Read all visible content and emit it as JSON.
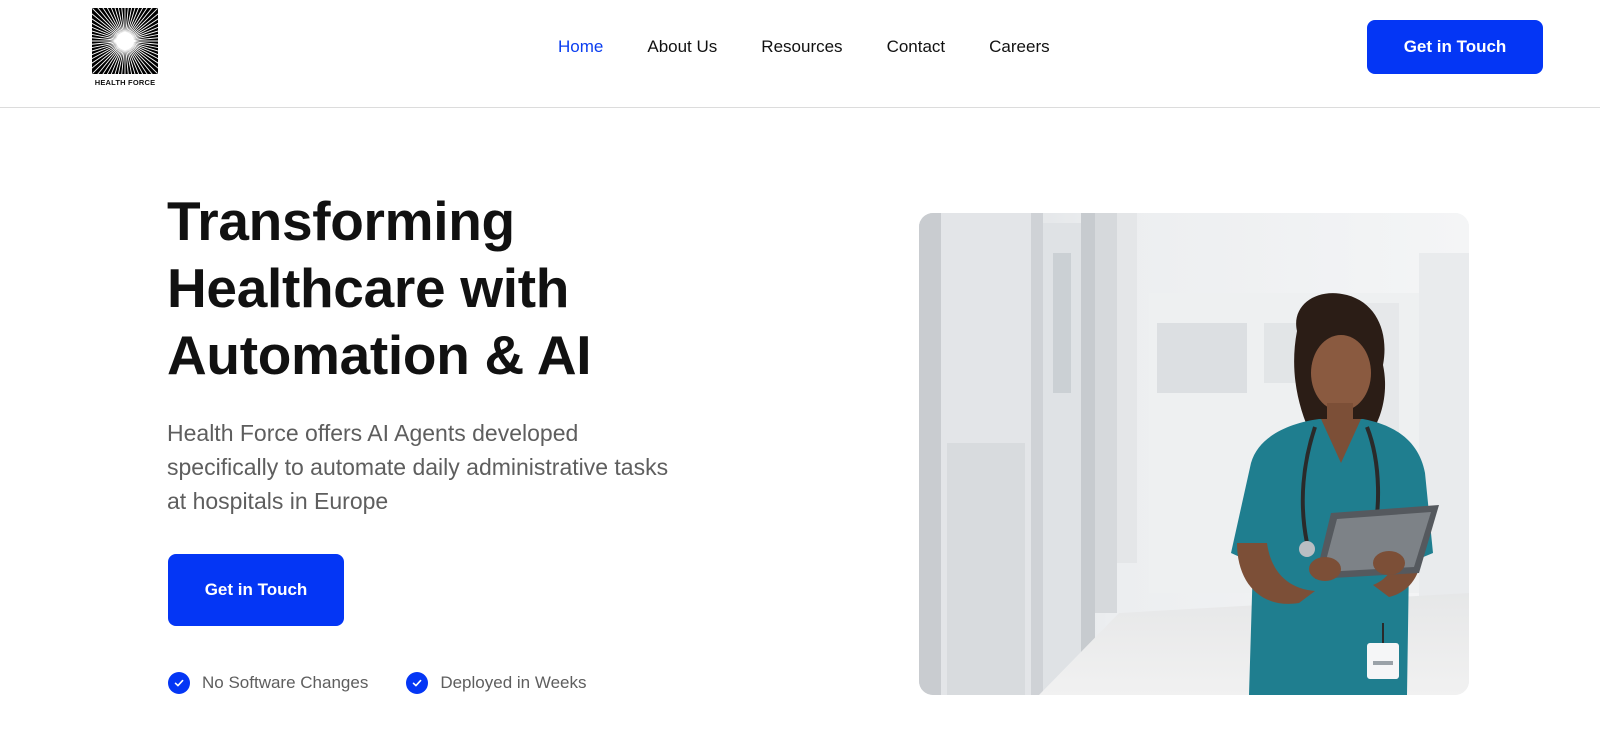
{
  "brand": {
    "name": "HEALTH FORCE"
  },
  "nav": {
    "items": [
      {
        "label": "Home",
        "active": true
      },
      {
        "label": "About Us",
        "active": false
      },
      {
        "label": "Resources",
        "active": false
      },
      {
        "label": "Contact",
        "active": false
      },
      {
        "label": "Careers",
        "active": false
      }
    ],
    "cta_label": "Get in Touch"
  },
  "hero": {
    "title_lines": [
      "Transforming",
      "Healthcare with",
      "Automation & AI"
    ],
    "description_lines": [
      "Health Force offers AI Agents developed",
      "specifically to automate daily administrative tasks",
      "at hospitals in Europe"
    ],
    "cta_label": "Get in Touch",
    "checks": [
      "No Software Changes",
      "Deployed in Weeks"
    ]
  },
  "colors": {
    "accent": "#0436f5",
    "active_nav": "#0a3df0",
    "text": "#111111",
    "muted": "#5e5e5e",
    "scrubs": "#1f7e8f"
  },
  "icons": [
    "logo-sunburst-icon",
    "check-circle-icon"
  ]
}
